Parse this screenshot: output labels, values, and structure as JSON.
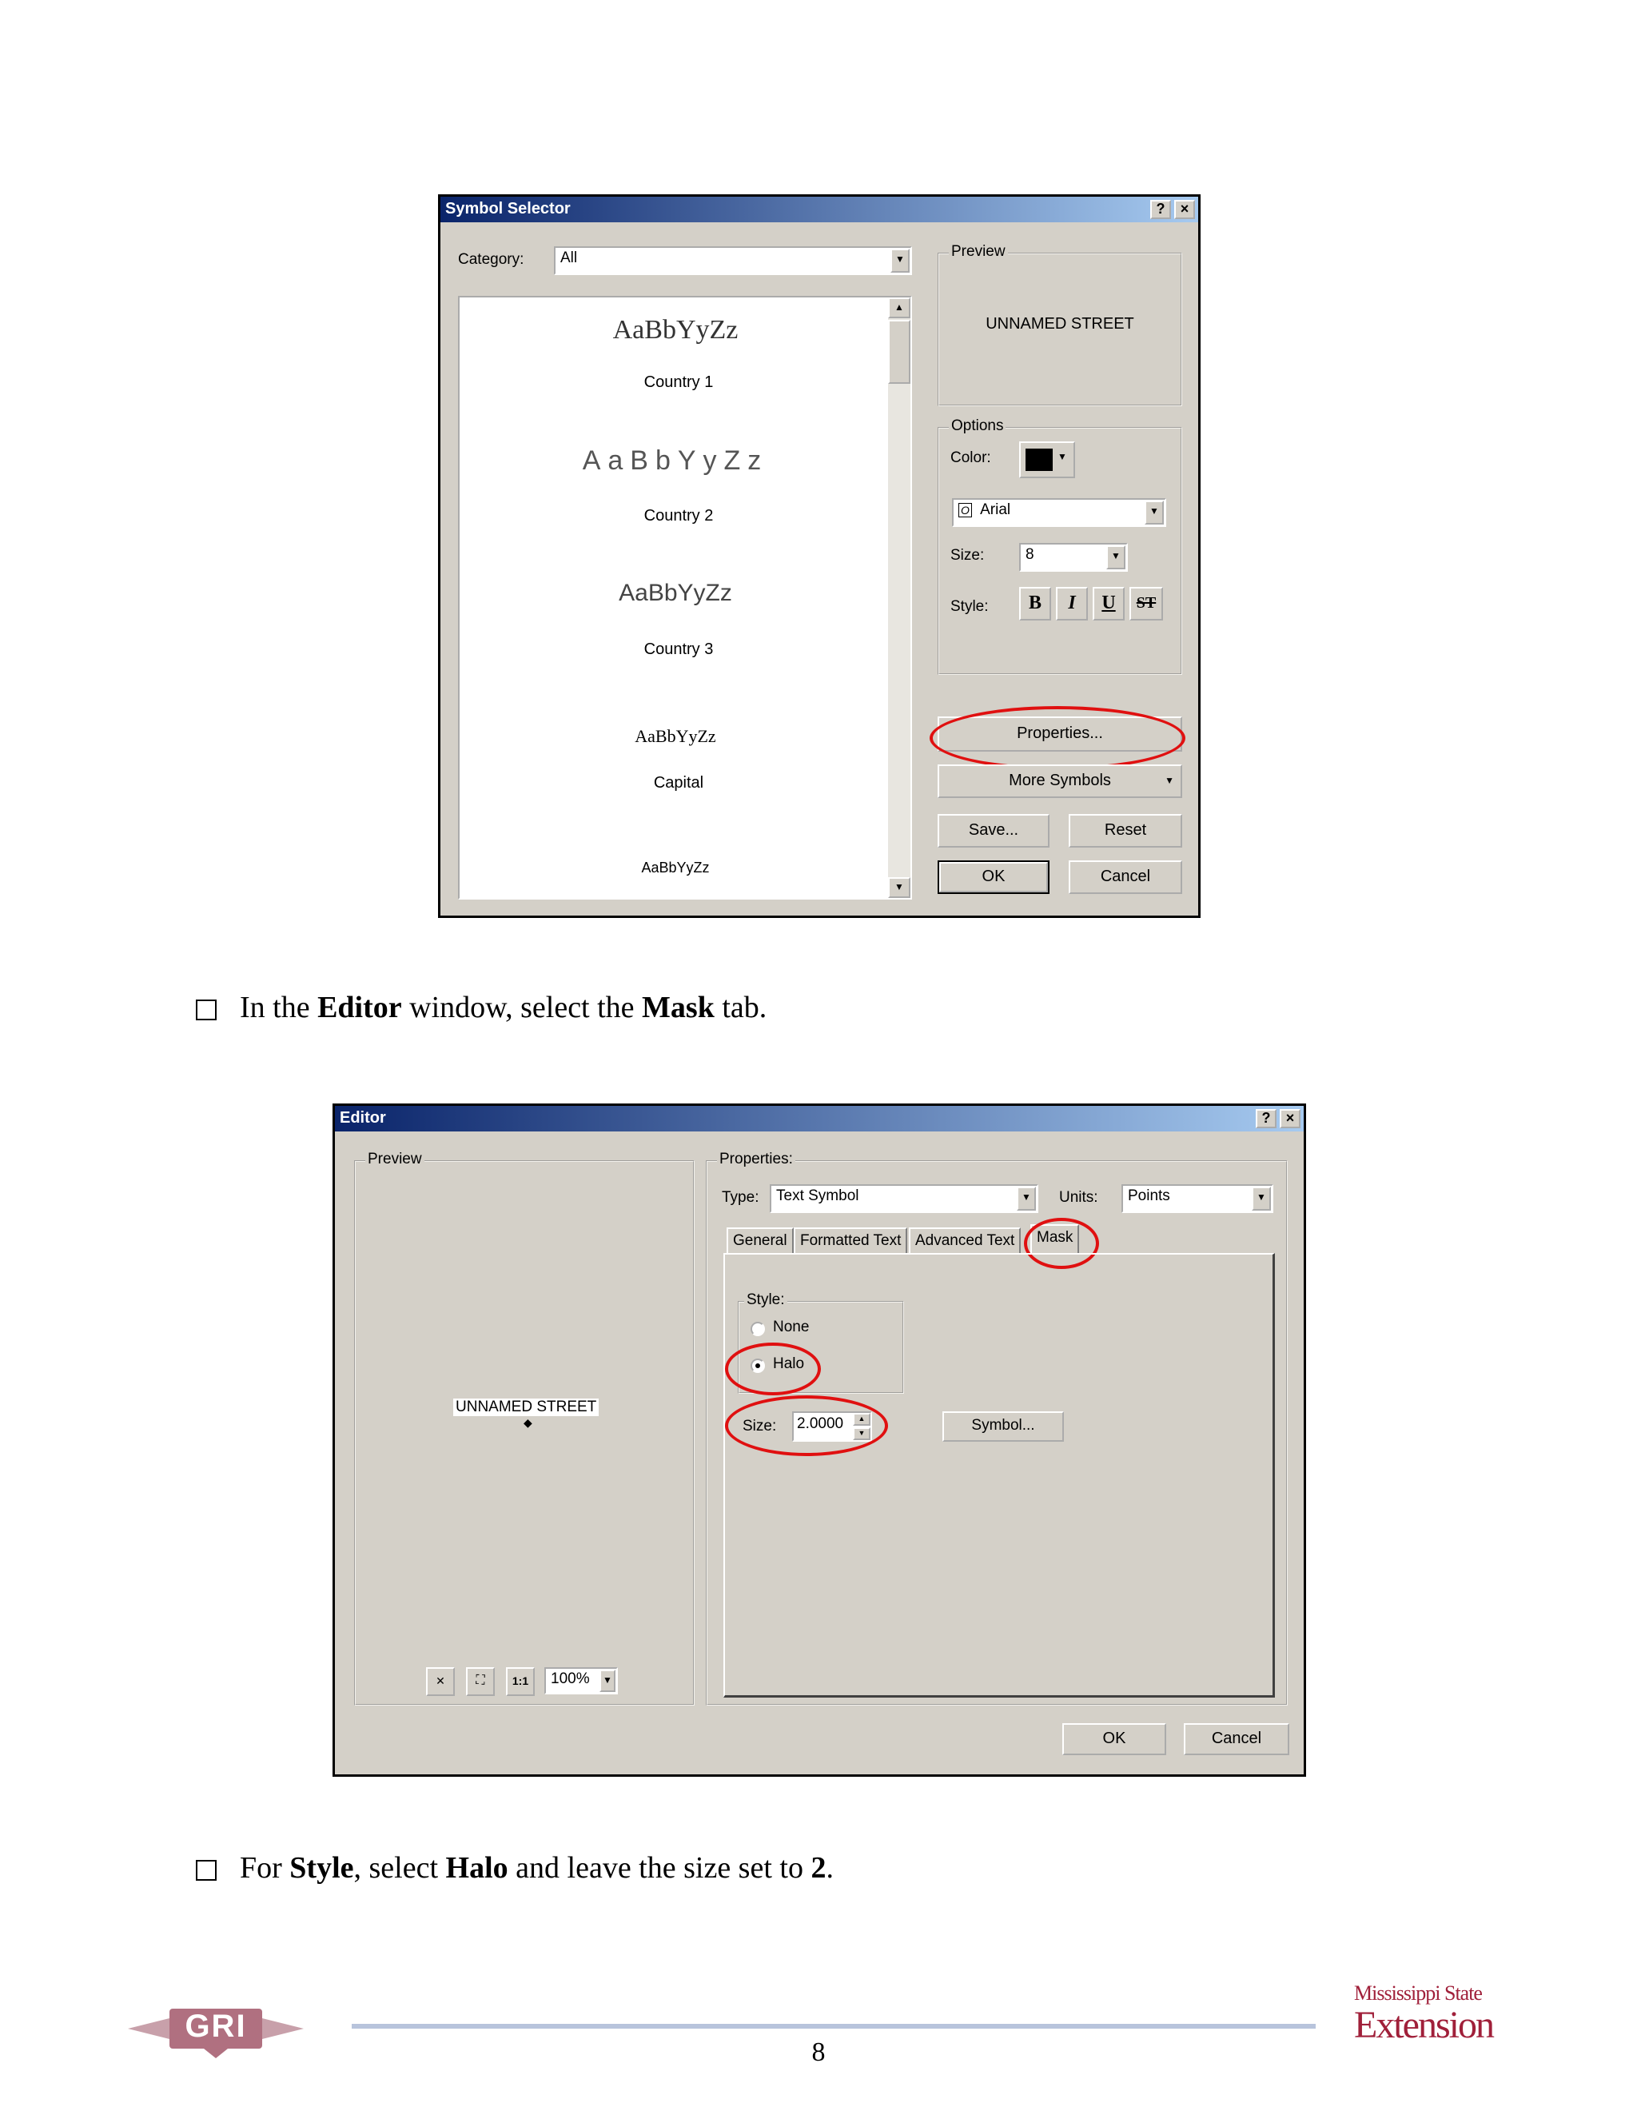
{
  "symbol_selector": {
    "title": "Symbol Selector",
    "help": "?",
    "close": "×",
    "category_label": "Category:",
    "category_value": "All",
    "symbols": [
      {
        "sample": "AaBbYyZz",
        "label": "Country 1"
      },
      {
        "sample": "AaBbYyZz",
        "label": "Country 2"
      },
      {
        "sample": "AaBbYyZz",
        "label": "Country 3"
      },
      {
        "sample": "AaBbYyZz",
        "label": "Capital"
      },
      {
        "sample": "AaBbYyZz",
        "label": ""
      }
    ],
    "preview_label": "Preview",
    "preview_text": "UNNAMED STREET",
    "options_label": "Options",
    "color_label": "Color:",
    "font_value": "Arial",
    "size_label": "Size:",
    "size_value": "8",
    "style_label": "Style:",
    "style_buttons": [
      "B",
      "I",
      "U",
      "ST"
    ],
    "properties_button": "Properties...",
    "more_symbols_button": "More Symbols",
    "save_button": "Save...",
    "reset_button": "Reset",
    "ok_button": "OK",
    "cancel_button": "Cancel"
  },
  "instruction1": {
    "parts": [
      "In the ",
      "Editor",
      " window, select the ",
      "Mask",
      " tab."
    ]
  },
  "editor": {
    "title": "Editor",
    "help": "?",
    "close": "×",
    "preview_label": "Preview",
    "preview_text": "UNNAMED STREET",
    "zoom_value": "100%",
    "properties_label": "Properties:",
    "type_label": "Type:",
    "type_value": "Text Symbol",
    "units_label": "Units:",
    "units_value": "Points",
    "tabs": [
      "General",
      "Formatted Text",
      "Advanced Text",
      "Mask"
    ],
    "style_group_label": "Style:",
    "radio_none": "None",
    "radio_halo": "Halo",
    "size_label": "Size:",
    "size_value": "2.0000",
    "symbol_button": "Symbol...",
    "ok_button": "OK",
    "cancel_button": "Cancel"
  },
  "instruction2": {
    "parts": [
      "For ",
      "Style",
      ", select ",
      "Halo",
      " and leave the size set to ",
      "2",
      "."
    ]
  },
  "footer": {
    "page_number": "8",
    "left_logo": "GRI",
    "right_logo_line1": "Mississippi State",
    "right_logo_line2": "Extension"
  },
  "colors": {
    "highlight": "#e01010",
    "dialog_bg": "#d4d0c8",
    "title_start": "#0a246a",
    "title_end": "#a6caf0",
    "footer_rule": "#b8c4dc",
    "logo_color": "#a0203a"
  }
}
